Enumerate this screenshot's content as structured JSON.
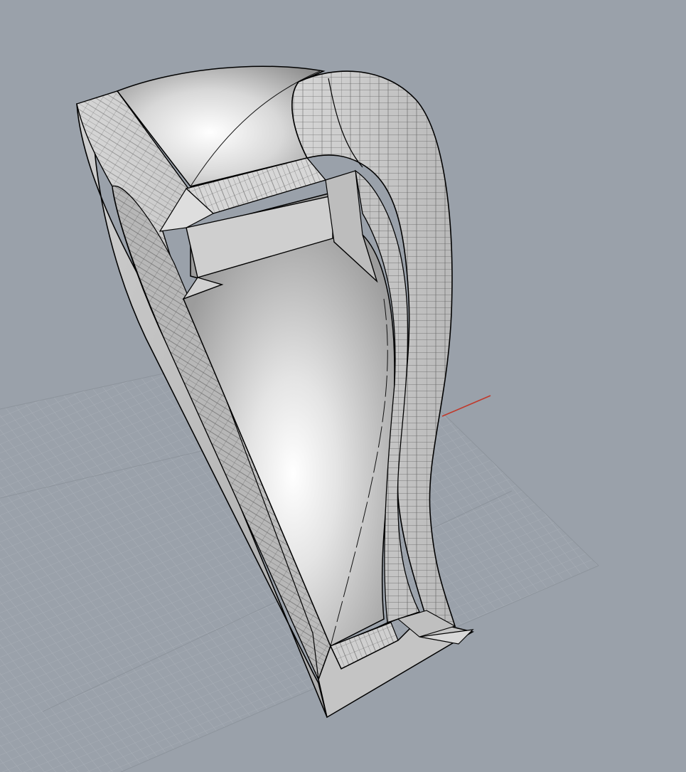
{
  "viewport": {
    "view": "perspective",
    "display_mode": "shaded",
    "background_color": "#9aa1aa",
    "grid": {
      "visible": true,
      "minor_line_color": "#a9b0b8",
      "major_line_color": "#8f969e"
    },
    "axes": {
      "x_axis_color": "#c0392b",
      "y_axis_visible": false
    },
    "model": {
      "shape": "curved-wing-shell",
      "surface_color": "#c9cacb",
      "highlight_color": "#ffffff",
      "edge_color": "#000000",
      "isocurve_color": "#1a1a1a"
    }
  }
}
